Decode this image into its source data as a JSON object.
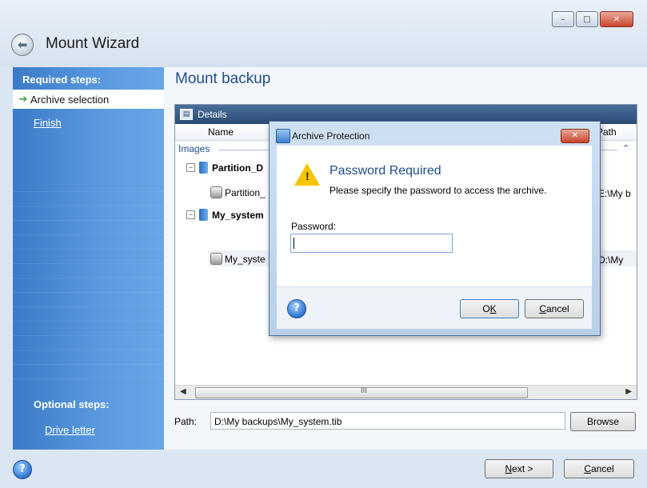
{
  "window": {
    "title": "Mount Wizard",
    "controls": [
      "–",
      "□",
      "✕"
    ]
  },
  "sidebar": {
    "required_heading": "Required steps:",
    "steps": [
      {
        "label": "Archive selection",
        "active": true
      },
      {
        "label": "Finish",
        "active": false
      }
    ],
    "optional_heading": "Optional steps:",
    "optional_steps": [
      {
        "label": "Drive letter"
      }
    ]
  },
  "main": {
    "title": "Mount backup",
    "details_label": "Details",
    "columns": {
      "name": "Name",
      "path": "Path"
    },
    "group_label": "Images",
    "rows": [
      {
        "name": "Partition_D",
        "path": "",
        "bold": true
      },
      {
        "name": "Partition_",
        "path": "E:\\My b"
      },
      {
        "name": "My_system",
        "path": "",
        "bold": true
      },
      {
        "name": "My_syste",
        "path": "D:\\My"
      }
    ],
    "scroll_grip": "III",
    "path_label": "Path:",
    "path_value": "D:\\My backups\\My_system.tib",
    "browse_label": "Browse"
  },
  "footer": {
    "next_label": "Next >",
    "next_mnemonic": "N",
    "cancel_label": "Cancel",
    "cancel_mnemonic": "C"
  },
  "dialog": {
    "title": "Archive Protection",
    "heading": "Password Required",
    "description": "Please specify the password to access the archive.",
    "password_label": "Password:",
    "password_value": "",
    "ok_label": "OK",
    "ok_mnemonic": "K",
    "cancel_label": "Cancel",
    "cancel_mnemonic": "C"
  },
  "colors": {
    "accent": "#1e4e8c",
    "sidebar": "#4a8ad6",
    "warning": "#f5c400"
  }
}
